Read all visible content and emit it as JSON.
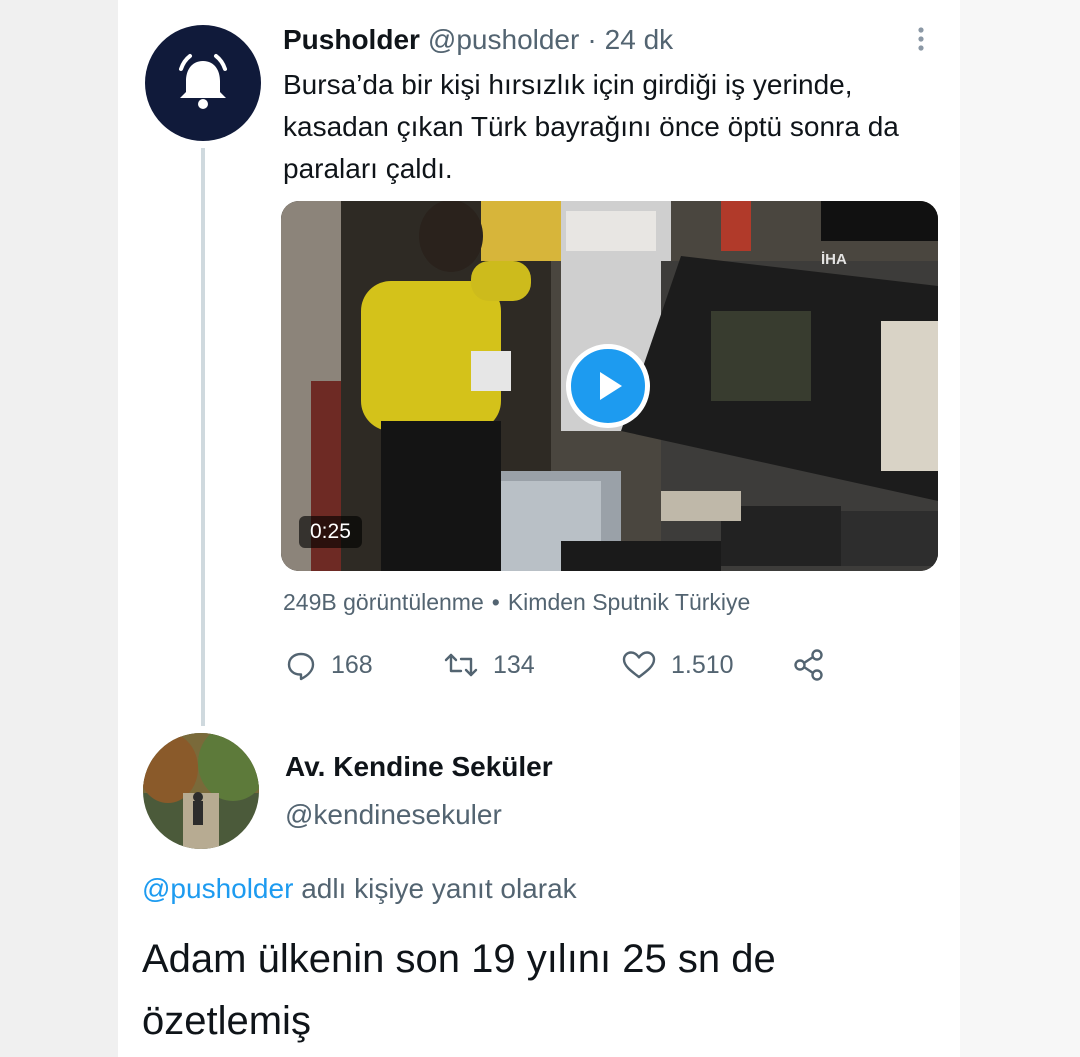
{
  "original_tweet": {
    "display_name": "Pusholder",
    "handle": "@pusholder",
    "separator": "·",
    "time": "24 dk",
    "avatar_icon": "bell-icon",
    "text": "Bursa’da bir kişi hırsızlık için girdiği iş yerinde, kasadan çıkan Türk bayrağını önce öptü sonra da paraları çaldı.",
    "media": {
      "type": "video",
      "duration": "0:25",
      "watermark": "İHA",
      "play_icon": "play-icon"
    },
    "views": "249B görüntülenme",
    "meta_separator": "•",
    "source": "Kimden Sputnik Türkiye",
    "actions": {
      "replies": "168",
      "retweets": "134",
      "likes": "1.510"
    }
  },
  "reply": {
    "display_name": "Av. Kendine Seküler",
    "handle": "@kendinesekuler",
    "replying_to_mention": "@pusholder",
    "replying_to_suffix": "adlı kişiye yanıt olarak",
    "text": "Adam ülkenin son 19 yılını 25 sn de özetlemiş"
  },
  "colors": {
    "accent": "#1d9bf0",
    "text_primary": "#0f1419",
    "text_secondary": "#536471",
    "bell_avatar_bg": "#101a3a"
  }
}
